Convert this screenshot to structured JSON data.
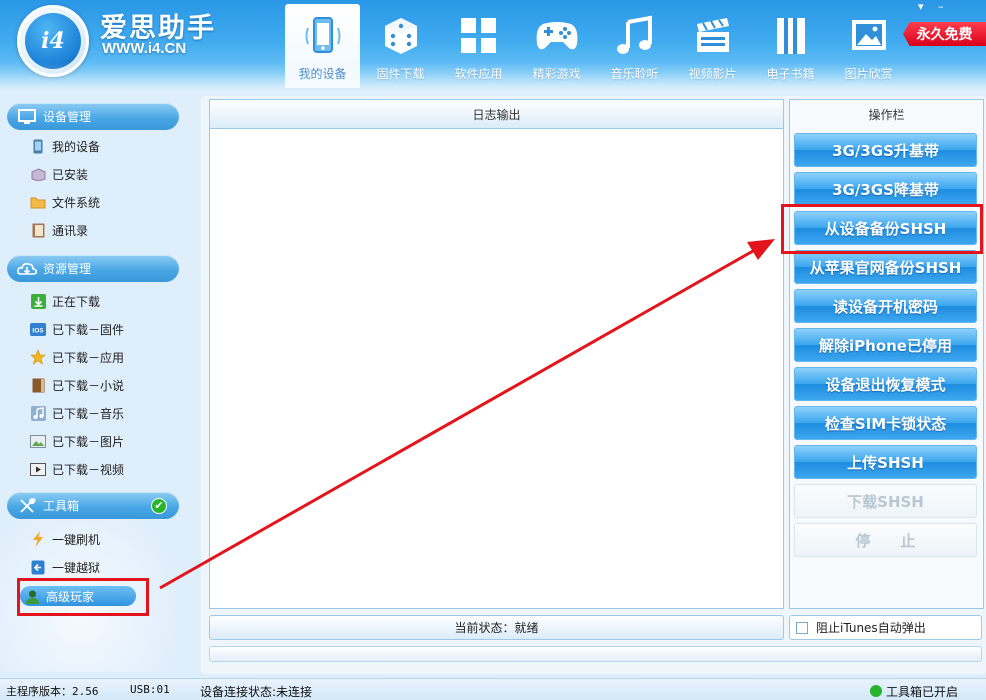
{
  "app": {
    "title": "爱思助手",
    "url": "WWW.i4.CN",
    "logo_text": "i4",
    "badge": "永久免费",
    "win_min": "▾",
    "win_dash": "–"
  },
  "nav": {
    "items": [
      {
        "label": "我的设备",
        "icon": "phone-icon",
        "active": true
      },
      {
        "label": "固件下载",
        "icon": "dice-box-icon"
      },
      {
        "label": "软件应用",
        "icon": "app-grid-icon"
      },
      {
        "label": "精彩游戏",
        "icon": "gamepad-icon"
      },
      {
        "label": "音乐聆听",
        "icon": "music-note-icon"
      },
      {
        "label": "视频影片",
        "icon": "clapperboard-icon"
      },
      {
        "label": "电子书籍",
        "icon": "book-icon"
      },
      {
        "label": "图片欣赏",
        "icon": "picture-icon"
      }
    ]
  },
  "sidebar": {
    "device_mgmt": {
      "title": "设备管理",
      "items": [
        {
          "label": "我的设备",
          "icon": "phone-icon"
        },
        {
          "label": "已安装",
          "icon": "box-icon"
        },
        {
          "label": "文件系统",
          "icon": "folder-icon"
        },
        {
          "label": "通讯录",
          "icon": "address-book-icon"
        }
      ]
    },
    "resource_mgmt": {
      "title": "资源管理",
      "items": [
        {
          "label": "正在下载",
          "icon": "download-icon"
        },
        {
          "label": "已下载－固件",
          "icon": "ios-icon"
        },
        {
          "label": "已下载－应用",
          "icon": "star-icon"
        },
        {
          "label": "已下载－小说",
          "icon": "book-icon"
        },
        {
          "label": "已下载－音乐",
          "icon": "music-icon"
        },
        {
          "label": "已下载－图片",
          "icon": "image-icon"
        },
        {
          "label": "已下载－视频",
          "icon": "video-icon"
        }
      ]
    },
    "toolbox": {
      "title": "工具箱",
      "check": "✔",
      "items": [
        {
          "label": "一键刷机",
          "icon": "lightning-icon"
        },
        {
          "label": "一键越狱",
          "icon": "jailbreak-icon"
        },
        {
          "label": "高级玩家",
          "icon": "user-icon",
          "active": true
        }
      ]
    }
  },
  "log_panel": {
    "title": "日志输出"
  },
  "ops_panel": {
    "title": "操作栏",
    "buttons": [
      {
        "label": "3G/3GS升基带",
        "enabled": true
      },
      {
        "label": "3G/3GS降基带",
        "enabled": true
      },
      {
        "label": "从设备备份SHSH",
        "enabled": true,
        "highlighted": true
      },
      {
        "label": "从苹果官网备份SHSH",
        "enabled": true
      },
      {
        "label": "读设备开机密码",
        "enabled": true
      },
      {
        "label": "解除iPhone已停用",
        "enabled": true
      },
      {
        "label": "设备退出恢复模式",
        "enabled": true
      },
      {
        "label": "检查SIM卡锁状态",
        "enabled": true
      },
      {
        "label": "上传SHSH",
        "enabled": true
      },
      {
        "label": "下载SHSH",
        "enabled": false
      },
      {
        "label": "停　　止",
        "enabled": false
      }
    ]
  },
  "status": {
    "current": "当前状态：就绪"
  },
  "itunes": {
    "label": "阻止iTunes自动弹出",
    "checked": false
  },
  "footer": {
    "version": "主程序版本：2.56",
    "usb": "USB:01",
    "device_status": "设备连接状态:未连接",
    "toolbox_status": "工具箱已开启"
  },
  "colors": {
    "accent": "#2f93df",
    "highlight": "#e3141b",
    "ok": "#27b52a"
  }
}
